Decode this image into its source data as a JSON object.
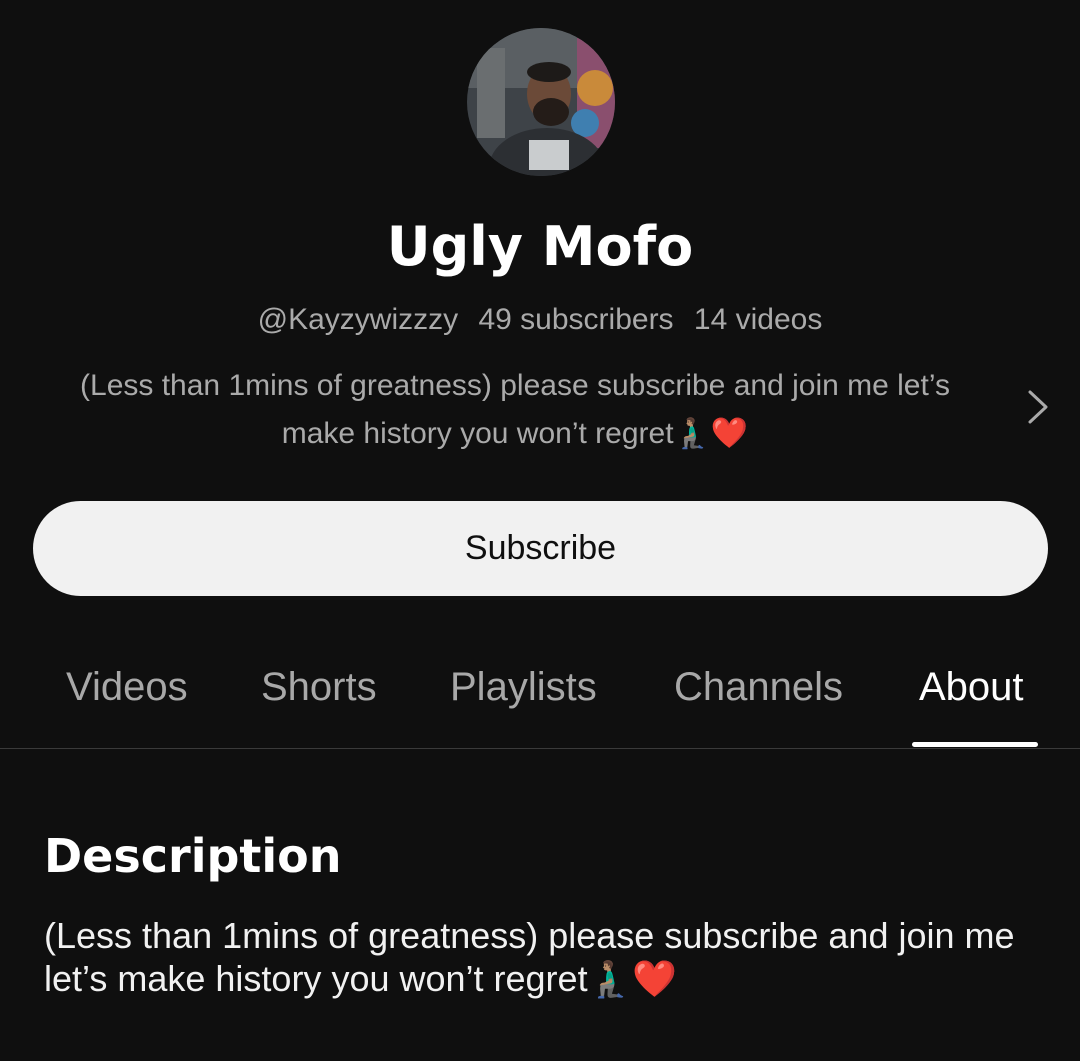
{
  "channel": {
    "name": "Ugly Mofo",
    "handle": "@Kayzywizzzy",
    "subscribers": "49 subscribers",
    "videos": "14 videos",
    "description_short": "(Less than 1mins of greatness) please subscribe and join me let’s make history you won’t regret🧎🏽‍♂️❤️",
    "avatar_icon": "channel-avatar"
  },
  "subscribe": {
    "label": "Subscribe"
  },
  "tabs": [
    {
      "label": "Videos"
    },
    {
      "label": "Shorts"
    },
    {
      "label": "Playlists"
    },
    {
      "label": "Channels"
    },
    {
      "label": "About",
      "active": true
    }
  ],
  "about": {
    "heading": "Description",
    "body": "(Less than 1mins of greatness) please subscribe and join me let’s make history you won’t regret🧎🏽‍♂️❤️"
  },
  "colors": {
    "background": "#0f0f0f",
    "button_bg": "#f1f1f1",
    "muted_text": "#aaaaaa"
  }
}
